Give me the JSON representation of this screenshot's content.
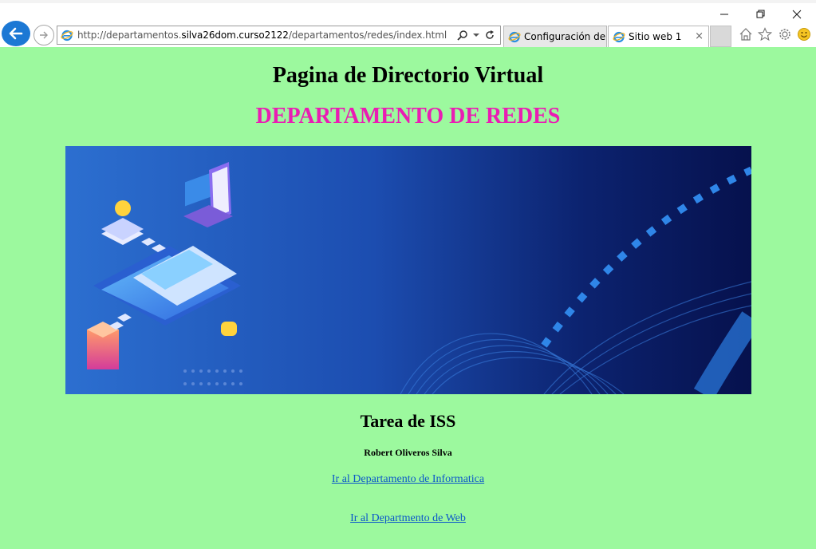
{
  "browser": {
    "url_prefix": "http://departamentos.",
    "url_domain": "silva26dom.curso2122",
    "url_path": "/departamentos/redes/index.html",
    "tabs": [
      {
        "title": "Configuración de...",
        "active": false
      },
      {
        "title": "Sitio web 1",
        "active": true
      }
    ],
    "close_tab_symbol": "×"
  },
  "page": {
    "heading": "Pagina de Directorio Virtual",
    "department": "DEPARTAMENTO DE REDES",
    "subheading": "Tarea de ISS",
    "author": "Robert Oliveros Silva",
    "links": [
      {
        "label": "Ir al Departamento de Informatica"
      },
      {
        "label": "Ir al Departmento de Web"
      }
    ]
  },
  "colors": {
    "page_background": "#9cf99e",
    "department_heading": "#ea1cb3",
    "link": "#0b57c9",
    "back_button": "#1c78d4"
  }
}
